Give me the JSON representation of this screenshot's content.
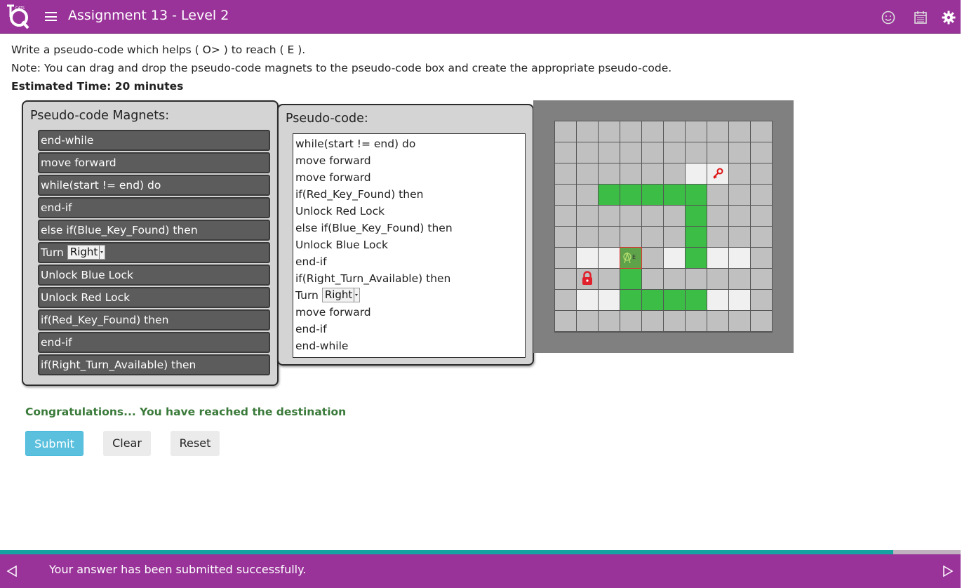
{
  "header": {
    "title": "Assignment 13 - Level 2",
    "logo_icon": "tq-logo-icon",
    "menu_icon": "hamburger-menu-icon",
    "right_icons": [
      "smiley-icon",
      "calendar-icon",
      "settings-gear-icon"
    ]
  },
  "instructions": {
    "line1": "Write a pseudo-code which helps ( O> ) to reach ( E ).",
    "line2": "Note: You can drag and drop the pseudo-code magnets to the pseudo-code box and create the appropriate pseudo-code.",
    "time": "Estimated Time: 20 minutes"
  },
  "magnets": {
    "title": "Pseudo-code Magnets:",
    "items": [
      {
        "label": "end-while"
      },
      {
        "label": "move forward"
      },
      {
        "label": "while(start != end) do"
      },
      {
        "label": "end-if"
      },
      {
        "label": "else if(Blue_Key_Found) then"
      },
      {
        "label": "Turn",
        "select": "Right"
      },
      {
        "label": "Unlock Blue Lock"
      },
      {
        "label": "Unlock Red Lock"
      },
      {
        "label": "if(Red_Key_Found) then"
      },
      {
        "label": "end-if"
      },
      {
        "label": "if(Right_Turn_Available) then"
      }
    ]
  },
  "code": {
    "title": "Pseudo-code:",
    "lines": [
      {
        "label": "while(start != end) do"
      },
      {
        "label": "move forward"
      },
      {
        "label": "move forward"
      },
      {
        "label": "if(Red_Key_Found) then"
      },
      {
        "label": "Unlock Red Lock"
      },
      {
        "label": "else if(Blue_Key_Found) then"
      },
      {
        "label": "Unlock Blue Lock"
      },
      {
        "label": "end-if"
      },
      {
        "label": "if(Right_Turn_Available) then"
      },
      {
        "label": "Turn",
        "select": "Right"
      },
      {
        "label": "move forward"
      },
      {
        "label": "end-if"
      },
      {
        "label": "end-while"
      }
    ]
  },
  "maze": {
    "rows": 10,
    "cols": 10,
    "cells": [
      "gggggggggg",
      "gggggggggg",
      "ggggggwkgg",
      "ggGGGGGggg",
      "ggggggGggg",
      "ggggggGggg",
      "gwwRgwGwwg",
      "glgGgggggg",
      "gwwGGGGwwg",
      "gggggggggg"
    ],
    "legend": {
      "g": "gray",
      "w": "white",
      "G": "green-path",
      "R": "robot",
      "k": "red-key",
      "l": "red-lock"
    },
    "colors": {
      "gray": "#c0c0c0",
      "white": "#f0f0f0",
      "green": "#3cbe46",
      "red": "#e0202a"
    }
  },
  "status": {
    "congrats": "Congratulations... You have reached the destination"
  },
  "buttons": {
    "submit": "Submit",
    "clear": "Clear",
    "reset": "Reset"
  },
  "footer": {
    "message": "Your answer has been submitted successfully.",
    "progress": 0.93,
    "prev_icon": "prev-arrow-icon",
    "next_icon": "next-arrow-icon"
  },
  "theme": {
    "brand": "#993399",
    "accent": "#5bc0de",
    "success": "#3a7a3a",
    "progress": "#17a2a2"
  }
}
